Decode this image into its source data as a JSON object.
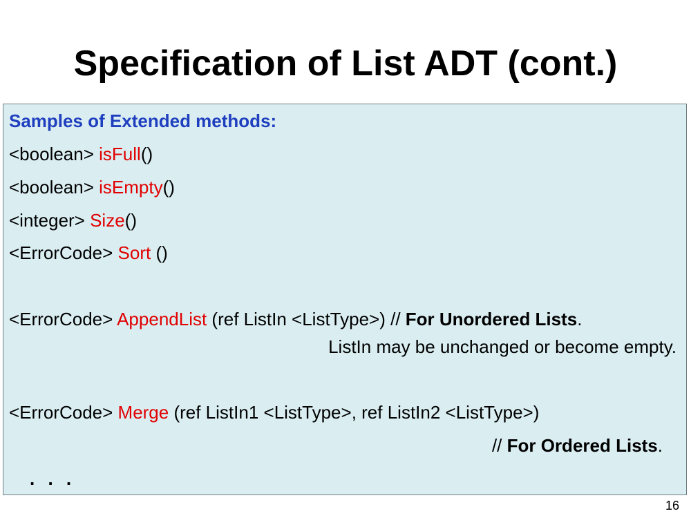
{
  "slide": {
    "title": "Specification of List ADT (cont.)",
    "page_number": "16"
  },
  "content": {
    "heading": "Samples of Extended methods:",
    "isfull": {
      "type": "<boolean> ",
      "name": "isFull",
      "args": "()"
    },
    "isempty": {
      "type": "<boolean> ",
      "name": "isEmpty",
      "args": "()"
    },
    "size": {
      "type": "<integer> ",
      "name": "Size",
      "args": "()"
    },
    "sort": {
      "type": "<ErrorCode> ",
      "name": "Sort",
      "args": " ()"
    },
    "appendlist": {
      "type": "<ErrorCode> ",
      "name": "AppendList",
      "params": " (ref ListIn <ListType>) // ",
      "comment": "For Unordered Lists",
      "period": ".",
      "note": "ListIn may be unchanged or become empty."
    },
    "merge": {
      "type": "<ErrorCode> ",
      "name": "Merge",
      "params": " (ref ListIn1 <ListType>, ref ListIn2 <ListType>)",
      "comment_prefix": "// ",
      "comment": "For Ordered Lists",
      "period": "."
    },
    "ellipsis": ". . ."
  },
  "colors": {
    "heading": "#1f3fbf",
    "method_name": "#e10000",
    "box_background": "#daeef2"
  }
}
